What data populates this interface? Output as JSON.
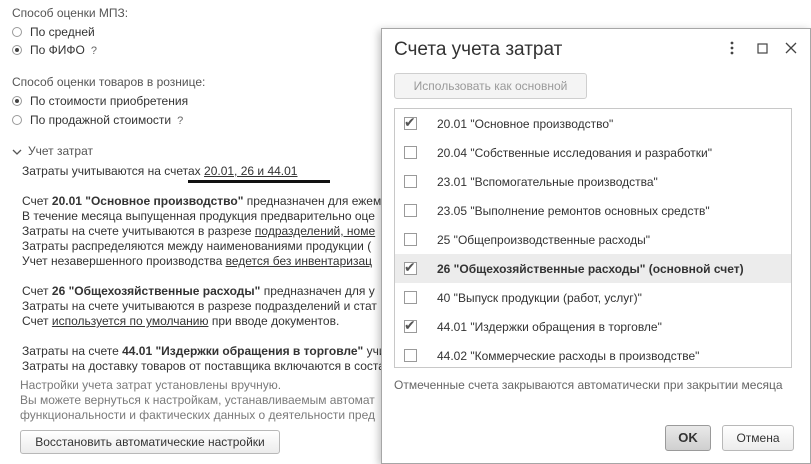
{
  "mpz": {
    "label": "Способ оценки МПЗ:",
    "opt1": "По средней",
    "opt2": "По ФИФО",
    "opt2_help": "?"
  },
  "retail": {
    "label": "Способ оценки товаров в рознице:",
    "opt1": "По стоимости приобретения",
    "opt2": "По продажной стоимости",
    "opt2_help": "?"
  },
  "costs": {
    "section": "Учет затрат",
    "line_prefix": "Затраты учитываются на счетах",
    "line_link": "20.01, 26 и 44.01",
    "p1_1a": "Счет ",
    "p1_1b": "20.01 \"Основное производство\"",
    "p1_1c": " предназначен для ежем",
    "p1_2": "В течение месяца выпущенная продукция предварительно оце",
    "p1_3a": "Затраты на счете учитываются в разрезе ",
    "p1_3b": "подразделений, номе",
    "p1_4": "Затраты распределяются между наименованиями продукции (",
    "p1_5a": "Учет незавершенного производства ",
    "p1_5b": "ведется без инвентаризац",
    "p2_1a": "Счет ",
    "p2_1b": "26 \"Общехозяйственные расходы\"",
    "p2_1c": " предназначен для у",
    "p2_2": "Затраты на счете учитываются в разрезе подразделений и стат",
    "p2_3a": "Счет ",
    "p2_3b": "используется по умолчанию",
    "p2_3c": " при вводе документов.",
    "p3_1a": "Затраты на счете ",
    "p3_1b": "44.01 \"Издержки обращения в торговле\"",
    "p3_1c": " учи",
    "p3_2": "Затраты на доставку товаров от поставщика включаются в соста",
    "n1": "Настройки учета затрат установлены вручную.",
    "n2": "Вы можете вернуться к настройкам, устанавливаемым автомат",
    "n3": "функциональности и фактических данных о деятельности пред",
    "restore_button": "Восстановить автоматические настройки"
  },
  "dialog": {
    "title": "Счета учета затрат",
    "use_main_button": "Использовать как основной",
    "items": [
      {
        "label": "20.01 \"Основное производство\"",
        "checked": true
      },
      {
        "label": "20.04 \"Собственные исследования и разработки\"",
        "checked": false
      },
      {
        "label": "23.01 \"Вспомогательные производства\"",
        "checked": false
      },
      {
        "label": "23.05 \"Выполнение ремонтов основных средств\"",
        "checked": false
      },
      {
        "label": "25 \"Общепроизводственные расходы\"",
        "checked": false
      },
      {
        "label": "26 \"Общехозяйственные расходы\" (основной счет)",
        "checked": true
      },
      {
        "label": "40 \"Выпуск продукции (работ, услуг)\"",
        "checked": false
      },
      {
        "label": "44.01 \"Издержки обращения в торговле\"",
        "checked": true
      },
      {
        "label": "44.02 \"Коммерческие расходы в производстве\"",
        "checked": false
      }
    ],
    "note": "Отмеченные счета закрываются автоматически при закрытии месяца",
    "ok_button": "OK",
    "cancel_button": "Отмена"
  }
}
